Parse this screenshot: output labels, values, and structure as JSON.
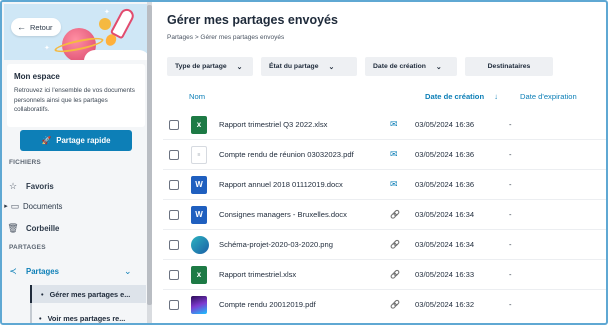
{
  "sidebar": {
    "back_label": "Retour",
    "space_title": "Mon espace",
    "space_desc": "Retrouvez ici l'ensemble de vos documents personnels ainsi que les partages collaboratifs.",
    "quick_share_label": "Partage rapide",
    "fichiers_label": "FICHIERS",
    "favoris_label": "Favoris",
    "documents_label": "Documents",
    "corbeille_label": "Corbeille",
    "partages_section_label": "PARTAGES",
    "partages_label": "Partages",
    "sub_sent_label": "Gérer mes partages e...",
    "sub_received_label": "Voir mes partages re..."
  },
  "main": {
    "title": "Gérer mes partages envoyés",
    "breadcrumb": "Partages  >  Gérer mes partages envoyés",
    "filters": [
      "Type de partage",
      "État du partage",
      "Date de création",
      "Destinataires"
    ],
    "columns": {
      "name": "Nom",
      "created": "Date de création",
      "sort_arrow": "↓",
      "expires": "Date d'expiration"
    },
    "rows": [
      {
        "name": "Rapport trimestriel Q3 2022.xlsx",
        "type": "xls",
        "share": "mail",
        "date": "03/05/2024 16:36",
        "expires": "-"
      },
      {
        "name": "Compte rendu de réunion 03032023.pdf",
        "type": "pdf",
        "share": "mail",
        "date": "03/05/2024 16:36",
        "expires": "-"
      },
      {
        "name": "Rapport annuel 2018 01112019.docx",
        "type": "doc",
        "share": "mail",
        "date": "03/05/2024 16:36",
        "expires": "-"
      },
      {
        "name": "Consignes managers - Bruxelles.docx",
        "type": "doc",
        "share": "link",
        "date": "03/05/2024 16:34",
        "expires": "-"
      },
      {
        "name": "Schéma-projet-2020-03-2020.png",
        "type": "png",
        "share": "link",
        "date": "03/05/2024 16:34",
        "expires": "-"
      },
      {
        "name": "Rapport trimestriel.xlsx",
        "type": "xls",
        "share": "link",
        "date": "03/05/2024 16:33",
        "expires": "-"
      },
      {
        "name": "Compte rendu 20012019.pdf",
        "type": "pdf2",
        "share": "link",
        "date": "03/05/2024 16:32",
        "expires": "-"
      }
    ]
  },
  "colors": {
    "accent": "#0d7fb7",
    "excel": "#1d7a45",
    "word": "#1f5fbf"
  }
}
